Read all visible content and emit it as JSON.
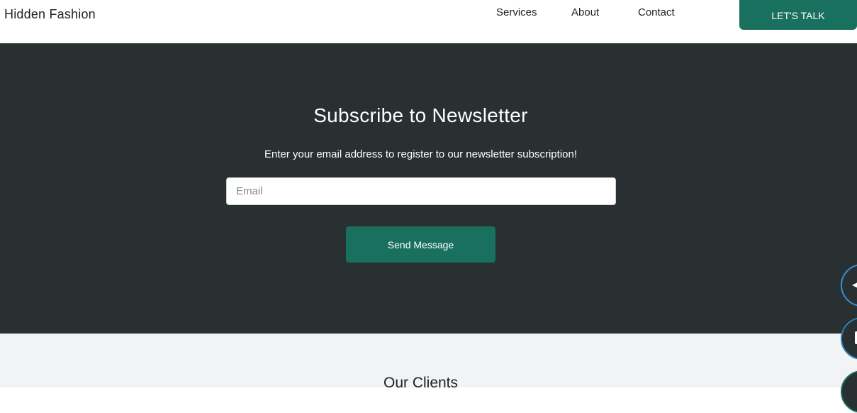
{
  "header": {
    "brand": "Hidden Fashion",
    "nav": {
      "services": "Services",
      "about": "About",
      "contact": "Contact"
    },
    "cta_label": "LET'S TALK"
  },
  "newsletter": {
    "title": "Subscribe to Newsletter",
    "subtitle": "Enter your email address to register to our newsletter subscription!",
    "email_placeholder": "Email",
    "email_value": "",
    "send_label": "Send Message"
  },
  "clients": {
    "title": "Our Clients"
  },
  "colors": {
    "accent": "#19705e",
    "dark_section": "#283031",
    "light_section": "#f1f3f5"
  },
  "floating_actions": [
    {
      "icon": "back-arrow-icon"
    },
    {
      "icon": "chat-icon"
    },
    {
      "icon": "action-icon"
    }
  ]
}
